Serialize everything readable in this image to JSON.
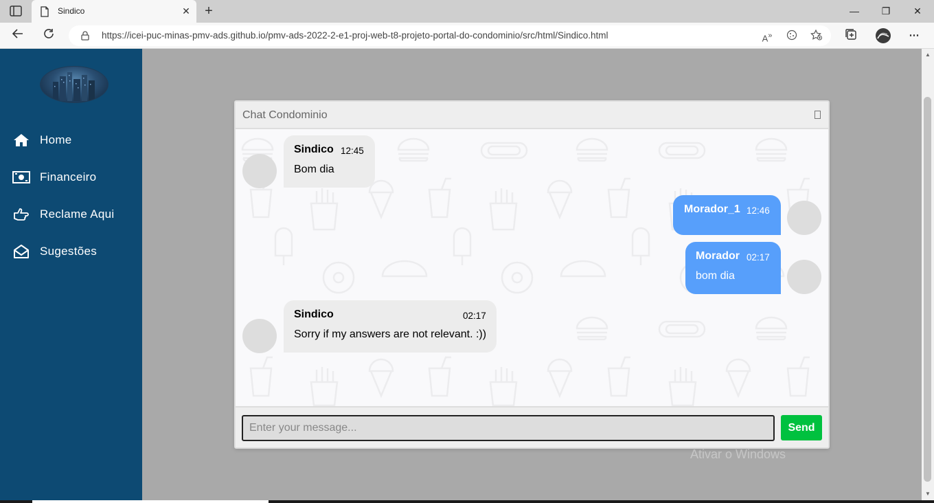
{
  "browser": {
    "tab_title": "Sindico",
    "url": "https://icei-puc-minas-pmv-ads.github.io/pmv-ads-2022-2-e1-proj-web-t8-projeto-portal-do-condominio/src/html/Sindico.html"
  },
  "sidebar": {
    "items": [
      {
        "label": "Home",
        "icon": "home-icon"
      },
      {
        "label": "Financeiro",
        "icon": "money-icon"
      },
      {
        "label": "Reclame Aqui",
        "icon": "hand-point-icon"
      },
      {
        "label": "Sugestões",
        "icon": "envelope-open-icon"
      }
    ]
  },
  "chat": {
    "title": "Chat Condominio",
    "messages": [
      {
        "side": "left",
        "name": "Sindico",
        "time": "12:45",
        "text": "Bom dia"
      },
      {
        "side": "right",
        "name": "Morador_1",
        "time": "12:46",
        "text": ""
      },
      {
        "side": "right",
        "name": "Morador",
        "time": "02:17",
        "text": "bom dia"
      },
      {
        "side": "left",
        "name": "Sindico",
        "time": "02:17",
        "text": "Sorry if my answers are not relevant. :))"
      }
    ],
    "input_placeholder": "Enter your message...",
    "send_label": "Send"
  },
  "os": {
    "watermark": "Ativar o Windows"
  },
  "colors": {
    "sidebar_bg": "#0d4a73",
    "bubble_left": "#ececec",
    "bubble_right": "#579ffb",
    "send_button": "#00c13f"
  }
}
